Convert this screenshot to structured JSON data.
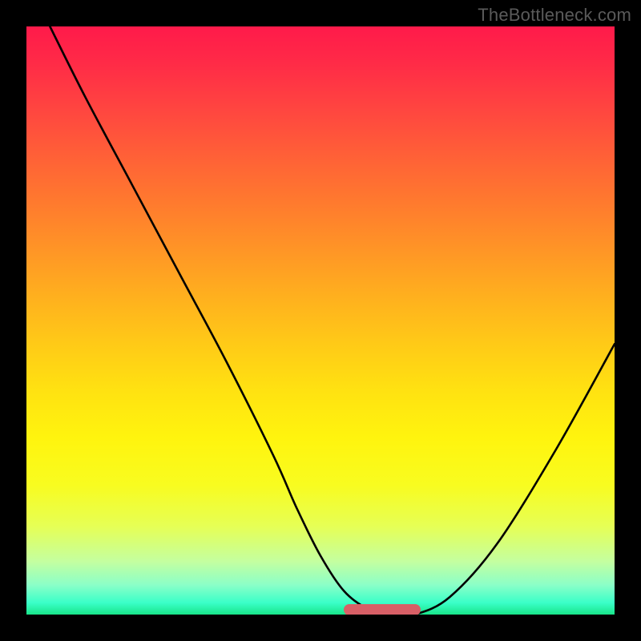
{
  "watermark": "TheBottleneck.com",
  "chart_data": {
    "type": "line",
    "title": "",
    "xlabel": "",
    "ylabel": "",
    "xlim": [
      0,
      100
    ],
    "ylim": [
      0,
      100
    ],
    "grid": false,
    "legend": false,
    "series": [
      {
        "name": "curve",
        "x": [
          4,
          10,
          18,
          26,
          34,
          42,
          46,
          50,
          54,
          58,
          62,
          66,
          72,
          80,
          90,
          100
        ],
        "values": [
          100,
          88,
          73,
          58,
          43,
          27,
          18,
          10,
          4,
          1,
          0,
          0,
          3,
          12,
          28,
          46
        ]
      }
    ],
    "accent_segment": {
      "x_start": 54,
      "x_end": 67,
      "y": 0.5
    },
    "gradient_stops": [
      {
        "pos": 0.0,
        "color": "#ff1a4a"
      },
      {
        "pos": 0.3,
        "color": "#ff7a2e"
      },
      {
        "pos": 0.62,
        "color": "#ffe211"
      },
      {
        "pos": 0.85,
        "color": "#e6ff55"
      },
      {
        "pos": 1.0,
        "color": "#18e58a"
      }
    ]
  }
}
